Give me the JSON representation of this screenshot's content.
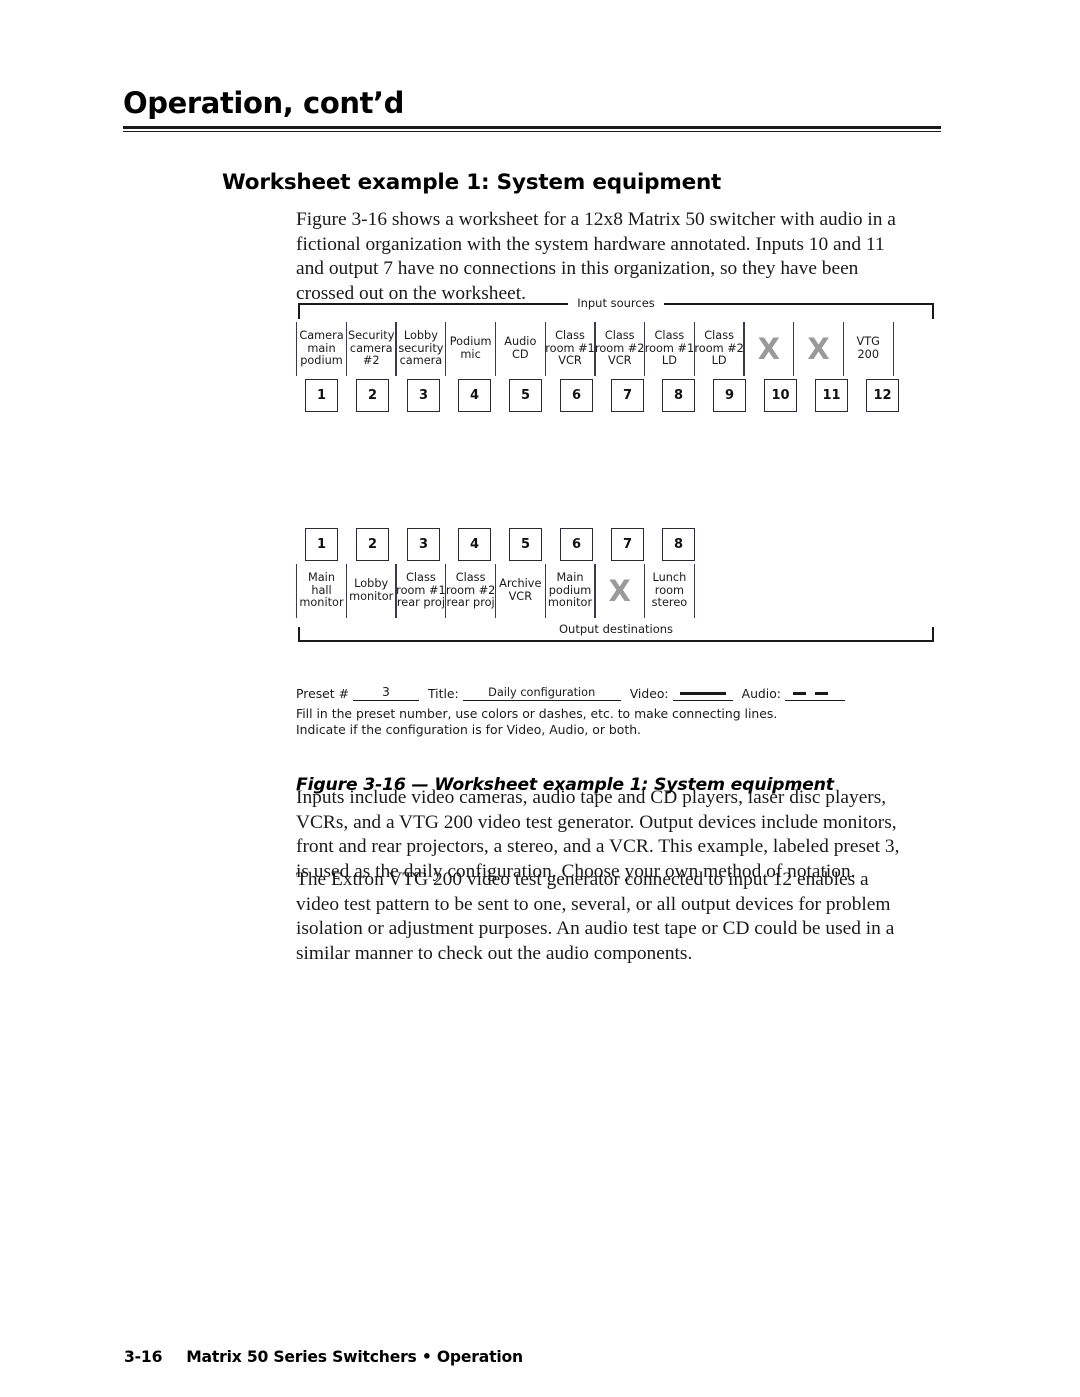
{
  "header": {
    "title": "Operation, cont’d"
  },
  "section": {
    "heading": "Worksheet example 1:  System equipment"
  },
  "paragraphs": {
    "intro": "Figure 3-16 shows a worksheet for a 12x8 Matrix 50 switcher with audio in a fictional organization with the system hardware annotated.  Inputs 10 and 11 and output 7 have no connections in this organization, so they have been crossed out on the worksheet.",
    "inputs": "Inputs include video cameras, audio tape and CD players, laser disc players, VCRs, and a VTG 200 video test generator.  Output devices include monitors, front and rear projectors, a stereo, and a VCR.  This example, labeled preset 3, is used as the daily configuration.  Choose your own method of notation.",
    "vtg": "The Extron VTG 200 video test generator connected to input 12 enables a video test pattern to be sent to one, several, or all output devices for problem isolation or adjustment purposes.  An audio test tape or CD could be used in a similar manner to check out the audio components."
  },
  "figure": {
    "caption": "Figure 3-16 — Worksheet example 1:  System equipment",
    "input_bracket_label": "Input sources",
    "output_bracket_label": "Output destinations",
    "crossed_out_mark": "X",
    "crossed_out_color": "#9a9a9a",
    "inputs": [
      {
        "number": "1",
        "lines": [
          "Camera",
          "main",
          "podium"
        ],
        "crossed": false
      },
      {
        "number": "2",
        "lines": [
          "Security",
          "camera",
          "#2"
        ],
        "crossed": false
      },
      {
        "number": "3",
        "lines": [
          "Lobby",
          "security",
          "camera"
        ],
        "crossed": false
      },
      {
        "number": "4",
        "lines": [
          "Podium",
          "mic"
        ],
        "crossed": false
      },
      {
        "number": "5",
        "lines": [
          "Audio",
          "CD"
        ],
        "crossed": false
      },
      {
        "number": "6",
        "lines": [
          "Class",
          "room #1",
          "VCR"
        ],
        "crossed": false
      },
      {
        "number": "7",
        "lines": [
          "Class",
          "room #2",
          "VCR"
        ],
        "crossed": false
      },
      {
        "number": "8",
        "lines": [
          "Class",
          "room #1",
          "LD"
        ],
        "crossed": false
      },
      {
        "number": "9",
        "lines": [
          "Class",
          "room #2",
          "LD"
        ],
        "crossed": false
      },
      {
        "number": "10",
        "lines": [],
        "crossed": true
      },
      {
        "number": "11",
        "lines": [],
        "crossed": true
      },
      {
        "number": "12",
        "lines": [
          "VTG",
          "200"
        ],
        "crossed": false
      }
    ],
    "outputs": [
      {
        "number": "1",
        "lines": [
          "Main",
          "hall",
          "monitor"
        ],
        "crossed": false
      },
      {
        "number": "2",
        "lines": [
          "Lobby",
          "monitor"
        ],
        "crossed": false
      },
      {
        "number": "3",
        "lines": [
          "Class",
          "room #1",
          "rear proj"
        ],
        "crossed": false
      },
      {
        "number": "4",
        "lines": [
          "Class",
          "room #2",
          "rear proj"
        ],
        "crossed": false
      },
      {
        "number": "5",
        "lines": [
          "Archive",
          "VCR"
        ],
        "crossed": false
      },
      {
        "number": "6",
        "lines": [
          "Main",
          "podium",
          "monitor"
        ],
        "crossed": false
      },
      {
        "number": "7",
        "lines": [],
        "crossed": true
      },
      {
        "number": "8",
        "lines": [
          "Lunch",
          "room",
          "stereo"
        ],
        "crossed": false
      }
    ],
    "preset": {
      "preset_label": "Preset #",
      "preset_value": "3",
      "title_label": "Title:",
      "title_value": "Daily configuration",
      "video_label": "Video:",
      "video_style": "solid",
      "audio_label": "Audio:",
      "audio_style": "dashed",
      "instruction_line_1": "Fill in the preset number, use colors or dashes, etc. to make connecting lines.",
      "instruction_line_2": "Indicate if the configuration is for Video, Audio, or both."
    }
  },
  "footer": {
    "page_number": "3-16",
    "document_title": "Matrix 50 Series Switchers • Operation"
  }
}
